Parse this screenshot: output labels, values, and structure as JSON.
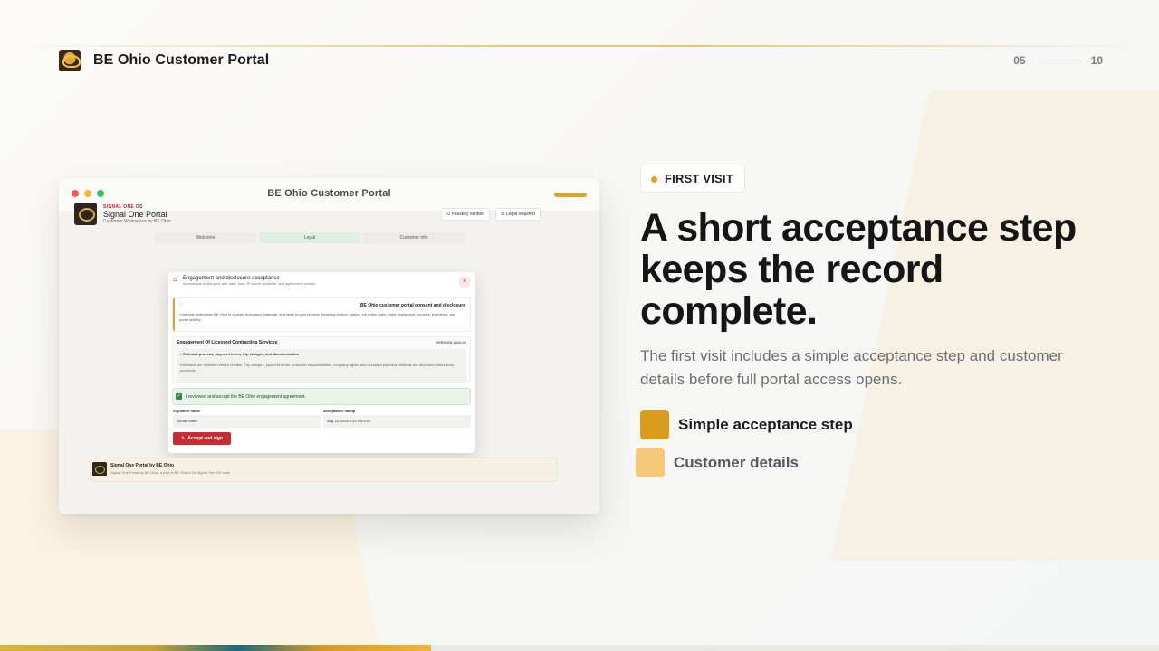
{
  "header": {
    "brand_title": "BE Ohio Customer Portal",
    "page_current": "05",
    "page_total": "10"
  },
  "screenshot": {
    "window_title": "BE Ohio Customer Portal",
    "portal": {
      "eyebrow": "SIGNAL ONE OS",
      "name": "Signal One Portal",
      "subtitle": "Customer Workspace by BE Ohio",
      "chips": [
        "Passkey verified",
        "Legal required"
      ]
    },
    "tabs": [
      {
        "label": "Welcome",
        "active": false
      },
      {
        "label": "Legal",
        "active": true
      },
      {
        "label": "Customer info",
        "active": false
      }
    ],
    "modal": {
      "title": "Engagement and disclosure acceptance",
      "subtitle": "Acceptance is stamped with date, time, IP where available, and agreement version.",
      "consent_title": "BE Ohio customer portal consent and disclosure",
      "consent_body": "Customer authorizes BE Ohio to access, document, estimate, and store project records, including photos, videos, job notes, calls, parts, equipment, invoices, payments, and portal activity.",
      "engagement_title": "Engagement Of Licensed Contracting Services",
      "version": "VERSION 2026.06",
      "summary": "▾ Estimate process, payment terms, trip charges, and documentation",
      "summary_text": "Estimates are reviewed before release. Trip charges, payment terms, customer responsibilities, company rights, and accepted payment methods are disclosed before work proceeds.",
      "checkbox_label": "I reviewed and accept the BE Ohio engagement agreement.",
      "signature_label": "Signature name",
      "signature_value": "Jordan Miller",
      "stamp_label": "Acceptance stamp",
      "stamp_value": "Aug 15, 2026 5:20 PM EDT",
      "accept_button": "Accept and sign"
    },
    "footer": {
      "title": "Signal One Portal by BE Ohio",
      "subtitle": "Signal One Portal by BE Ohio, a part of BE Ohio's full Signal One OS suite"
    }
  },
  "content": {
    "badge": "FIRST VISIT",
    "headline": "A short acceptance step keeps the record complete.",
    "subtext": "The first visit includes a simple acceptance step and customer details before full portal access opens.",
    "features": [
      {
        "label": "Simple acceptance step",
        "color": "#d99c1e"
      },
      {
        "label": "Customer details",
        "color": "#f4c97a"
      }
    ]
  },
  "progress": {
    "fraction": 0.372,
    "color": "#d8b341"
  }
}
